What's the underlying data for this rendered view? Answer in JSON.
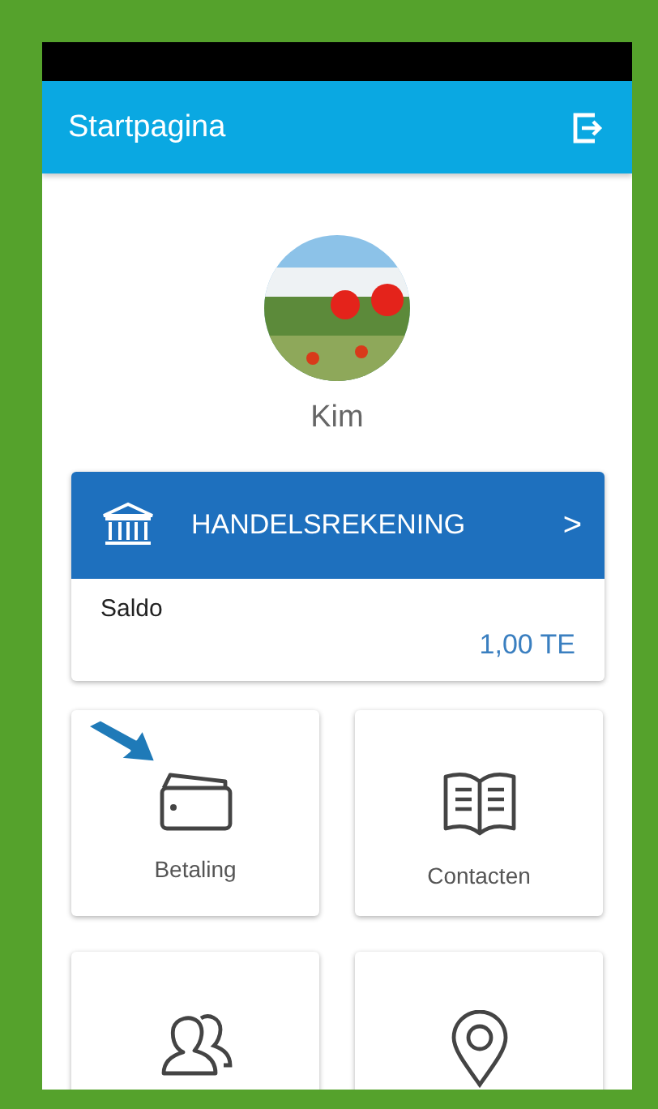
{
  "header": {
    "title": "Startpagina"
  },
  "profile": {
    "name": "Kim"
  },
  "account": {
    "title": "HANDELSREKENING",
    "chevron": ">",
    "balance_label": "Saldo",
    "balance": "1,00 TE"
  },
  "tiles": [
    {
      "kind": "wallet",
      "label": "Betaling",
      "pointed": true
    },
    {
      "kind": "book",
      "label": "Contacten",
      "pointed": false
    },
    {
      "kind": "people",
      "pointed": false
    },
    {
      "kind": "pin",
      "pointed": false
    }
  ]
}
